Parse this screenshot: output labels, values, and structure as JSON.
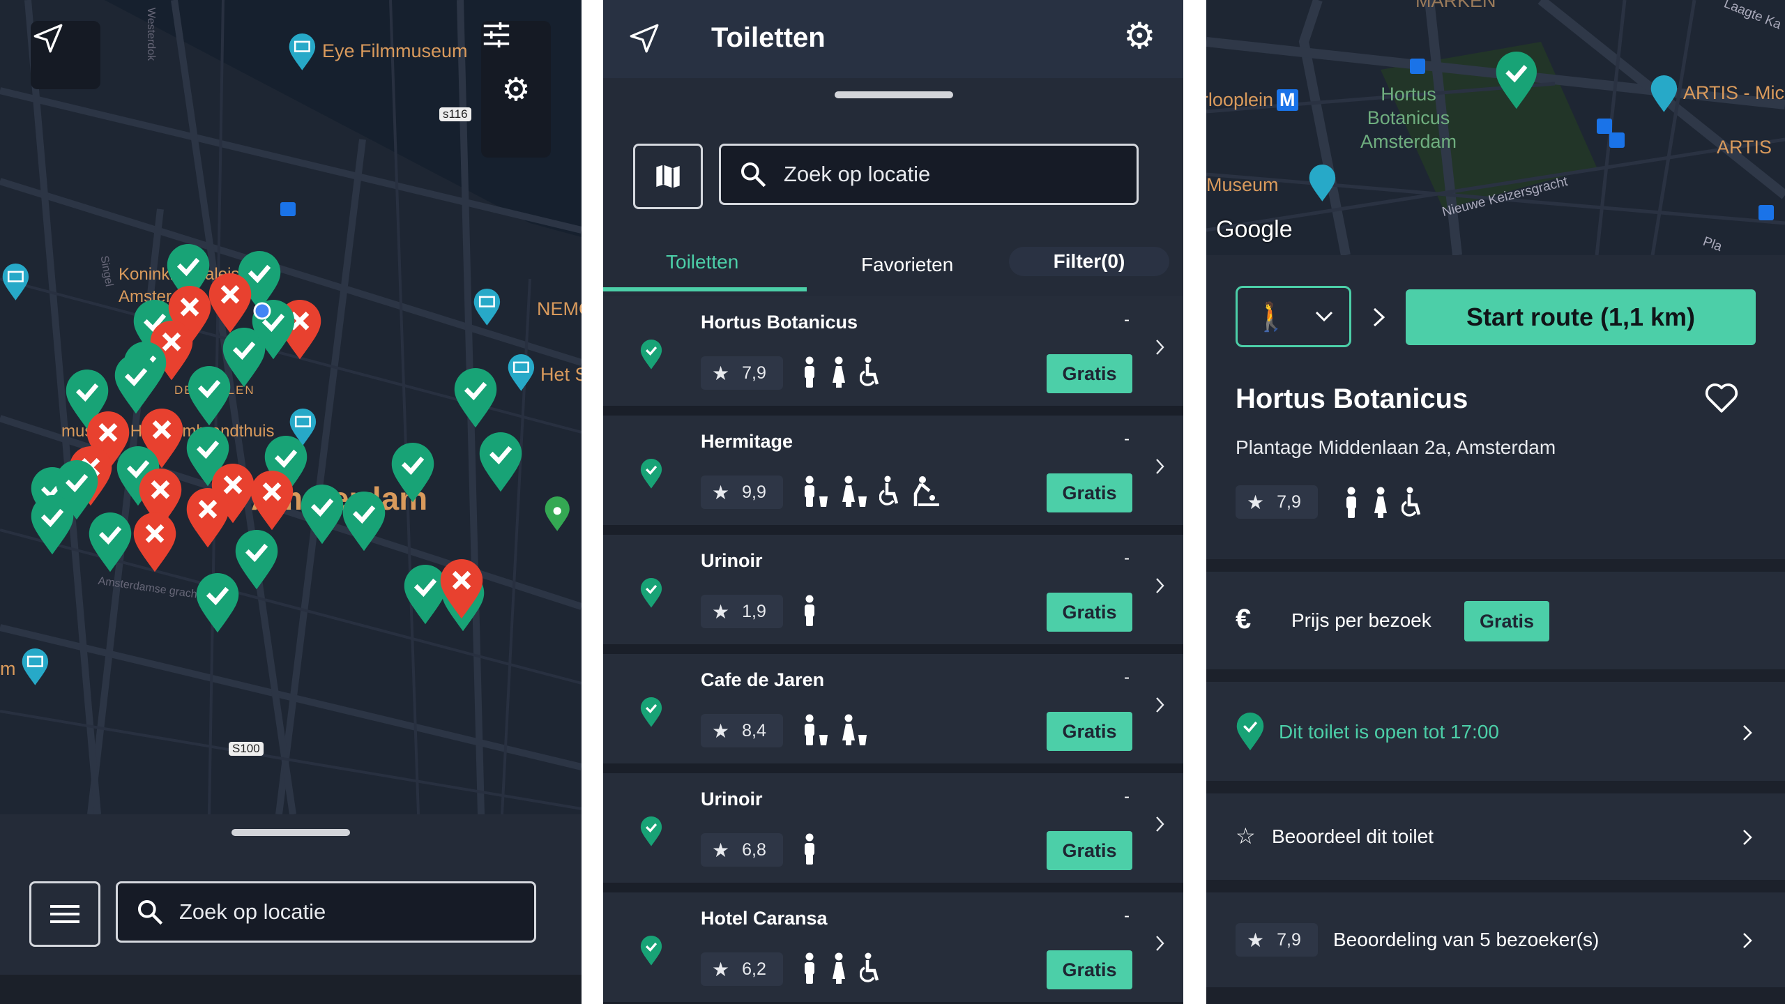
{
  "colors": {
    "accent": "#4ccfa8",
    "open_pin": "#18a376",
    "closed_pin": "#e8412f",
    "background": "#242b38",
    "map": "#1e2633"
  },
  "left": {
    "map_labels": [
      "Eye Filmmuseum",
      "Koninklijk Paleis Amsterdam",
      "NEMO S",
      "Het S",
      "museum Het Rembrandthuis",
      "Amsterdam",
      "DE WALLEN",
      "Westerdok",
      "Singel",
      "Amsterdamse gracht",
      "s116",
      "S100",
      "m"
    ],
    "locate_icon": "navigation-arrow-icon",
    "settings_icon": "gear-icon",
    "filter_icon": "sliders-icon",
    "menu_icon": "hamburger-icon",
    "search": {
      "placeholder": "Zoek op locatie",
      "icon": "search-icon"
    }
  },
  "middle": {
    "title": "Toiletten",
    "search": {
      "placeholder": "Zoek op locatie"
    },
    "tabs": [
      {
        "label": "Toiletten",
        "active": true
      },
      {
        "label": "Favorieten",
        "active": false
      },
      {
        "label": "Filter(0)",
        "active": false
      }
    ],
    "list": [
      {
        "name": "Hortus Botanicus",
        "distance": "-",
        "rating": "7,9",
        "amenities": [
          "man",
          "woman",
          "wheelchair"
        ],
        "price": "Gratis",
        "open": true
      },
      {
        "name": "Hermitage",
        "distance": "-",
        "rating": "9,9",
        "amenities": [
          "man-urinal",
          "woman-urinal",
          "wheelchair",
          "baby-change"
        ],
        "price": "Gratis",
        "open": true
      },
      {
        "name": "Urinoir",
        "distance": "-",
        "rating": "1,9",
        "amenities": [
          "man"
        ],
        "price": "Gratis",
        "open": true
      },
      {
        "name": "Cafe de Jaren",
        "distance": "-",
        "rating": "8,4",
        "amenities": [
          "man-urinal",
          "woman-urinal"
        ],
        "price": "Gratis",
        "open": true
      },
      {
        "name": "Urinoir",
        "distance": "-",
        "rating": "6,8",
        "amenities": [
          "man"
        ],
        "price": "Gratis",
        "open": true
      },
      {
        "name": "Hotel Caransa",
        "distance": "-",
        "rating": "6,2",
        "amenities": [
          "man",
          "woman",
          "wheelchair"
        ],
        "price": "Gratis",
        "open": true
      }
    ]
  },
  "right": {
    "map_labels": [
      "MARKEN",
      "Waterlooplein",
      "M",
      "Hortus Botanicus Amsterdam",
      "ARTIS - Mic",
      "ARTIS",
      "Museum",
      "Nieuwe Keizersgracht",
      "Laagte Ka",
      "Pla",
      "Google"
    ],
    "transport_mode": "walking",
    "start_route": "Start route (1,1 km)",
    "name": "Hortus Botanicus",
    "address": "Plantage Middenlaan 2a, Amsterdam",
    "rating": "7,9",
    "amenities": [
      "man",
      "woman",
      "wheelchair"
    ],
    "price_label": "Prijs per bezoek",
    "price": "Gratis",
    "open_text": "Dit toilet is open tot 17:00",
    "rate_label": "Beoordeel dit toilet",
    "reviews_rating": "7,9",
    "reviews_label": "Beoordeling van 5 bezoeker(s)"
  }
}
